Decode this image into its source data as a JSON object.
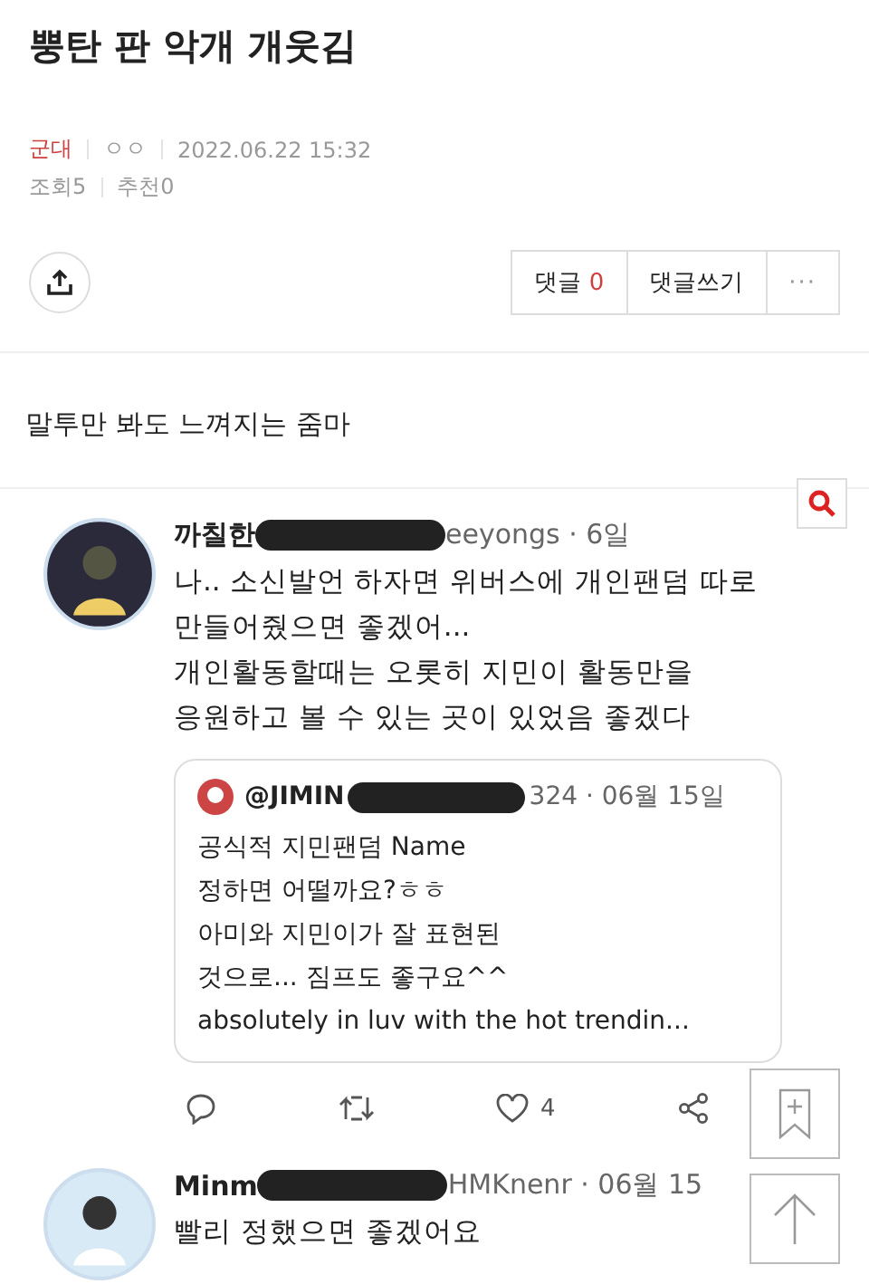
{
  "post": {
    "title": "뿡탄 판 악개 개웃김",
    "board": "군대",
    "author": "ㅇㅇ",
    "date": "2022.06.22 15:32",
    "views_label": "조회",
    "views": "5",
    "likes_label": "추천",
    "likes": "0"
  },
  "actions": {
    "comments_label": "댓글",
    "comments_count": "0",
    "write_comment": "댓글쓰기",
    "more": "···"
  },
  "body": "말투만 봐도 느껴지는 줌마",
  "tweets": [
    {
      "name_start": "까칠한",
      "name_end": "eeyongs · 6일",
      "lines": [
        "나.. 소신발언 하자면 위버스에 개인팬덤 따로",
        "만들어줬으면 좋겠어...",
        "개인활동할때는 오롯히 지민이 활동만을",
        "응원하고 볼 수 있는 곳이 있었음 좋겠다"
      ],
      "quote": {
        "name_start": "@JIMIN",
        "name_end": "324 · 06월 15일",
        "lines": [
          "공식적 지민팬덤 Name",
          "정하면 어떨까요?ㅎㅎ",
          "아미와 지민이가 잘 표현된",
          "것으로... 짐프도 좋구요^^",
          "absolutely in luv with the hot trendin..."
        ]
      },
      "like_count": "4"
    },
    {
      "name_start": "Minm",
      "name_end": "HMKnenr · 06월 15",
      "lines": [
        "빨리 정했으면 좋겠어요"
      ]
    }
  ]
}
